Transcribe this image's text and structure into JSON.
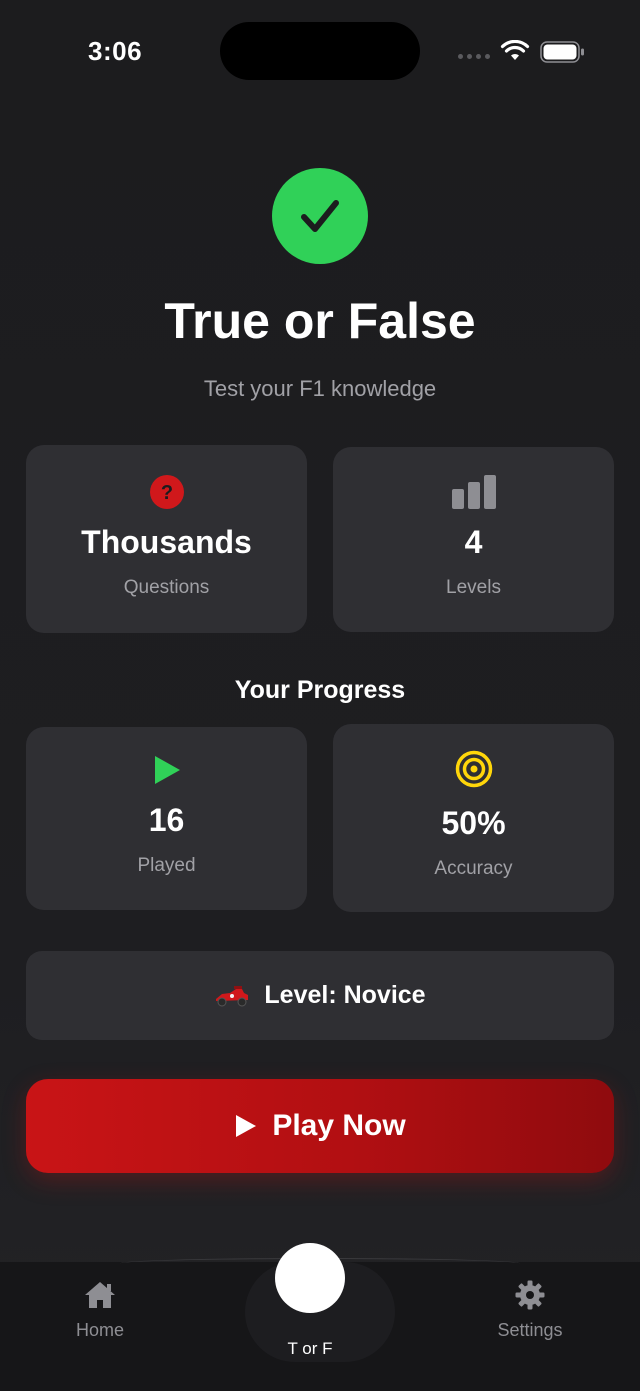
{
  "status_bar": {
    "time": "3:06"
  },
  "header": {
    "icon": "checkmark-circle-icon",
    "title": "True or False",
    "subtitle": "Test your F1 knowledge"
  },
  "stats": {
    "questions": {
      "icon": "question-circle-icon",
      "value": "Thousands",
      "label": "Questions"
    },
    "levels": {
      "icon": "bar-chart-icon",
      "value": "4",
      "label": "Levels"
    }
  },
  "progress": {
    "title": "Your Progress",
    "played": {
      "icon": "play-icon",
      "value": "16",
      "label": "Played"
    },
    "accuracy": {
      "icon": "target-icon",
      "value": "50%",
      "label": "Accuracy"
    }
  },
  "level": {
    "icon": "race-car-icon",
    "text": "Level: Novice"
  },
  "play_button": {
    "icon": "play-icon",
    "label": "Play Now"
  },
  "tab_bar": {
    "home": {
      "icon": "house-icon",
      "label": "Home"
    },
    "center": {
      "label": "T or F"
    },
    "settings": {
      "icon": "gear-icon",
      "label": "Settings"
    }
  },
  "colors": {
    "background": "#1c1c1e",
    "card": "#2f2f33",
    "accent_green": "#30d158",
    "accent_red": "#c91416",
    "accent_yellow": "#ffd60a",
    "question_red": "#d0181b",
    "muted_text": "#a1a1a6"
  }
}
